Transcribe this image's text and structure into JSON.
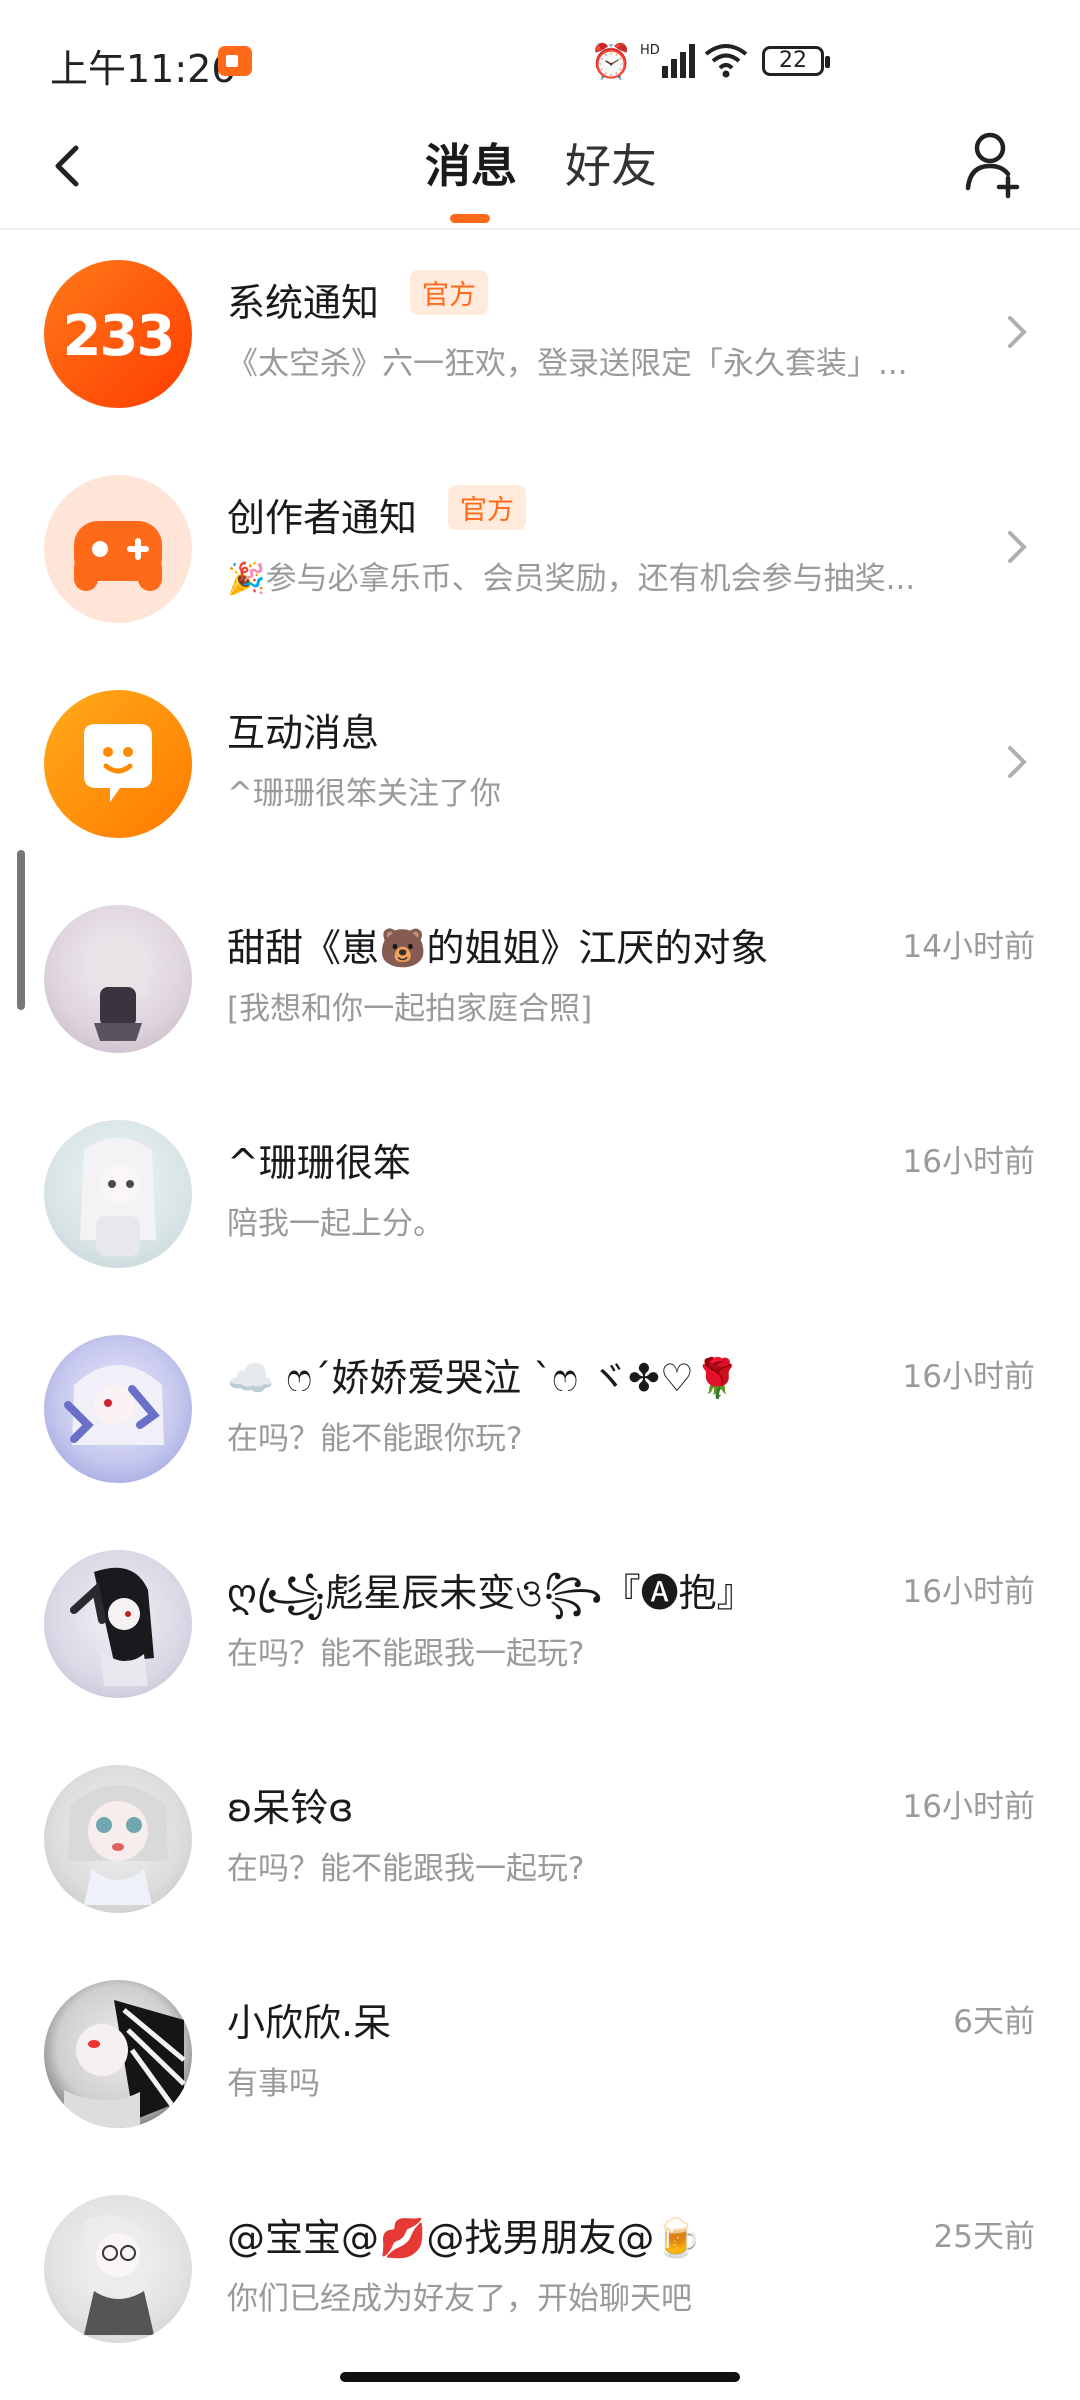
{
  "status_bar": {
    "time": "上午11:26",
    "network": "HD",
    "battery": "22"
  },
  "header": {
    "tab_active": "消息",
    "tab_other": "好友"
  },
  "notifications": [
    {
      "title": "系统通知",
      "badge": "官方",
      "subtitle": "《太空杀》六一狂欢，登录送限定「永久套装」...",
      "logo_text": "233"
    },
    {
      "title": "创作者通知",
      "badge": "官方",
      "subtitle": "🎉参与必拿乐币、会员奖励，还有机会参与抽奖..."
    },
    {
      "title": "互动消息",
      "subtitle": "^珊珊很笨关注了你"
    }
  ],
  "chats": [
    {
      "name": "甜甜《崽🐻的姐姐》江厌的对象",
      "message": "[我想和你一起拍家庭合照]",
      "time": "14小时前"
    },
    {
      "name": "^珊珊很笨",
      "message": "陪我一起上分。",
      "time": "16小时前"
    },
    {
      "name": "☁️ ෆ´娇娇爱哭泣 `ෆ ヾ✤♡🌹",
      "message": "在吗？能不能跟你玩?",
      "time": "16小时前"
    },
    {
      "name": "ღ꧁ꦿ彪星辰未变ও꧂『🅐抱』",
      "message": "在吗？能不能跟我一起玩?",
      "time": "16小时前"
    },
    {
      "name": "ʚ呆铃ɞ",
      "message": "在吗？能不能跟我一起玩?",
      "time": "16小时前"
    },
    {
      "name": "小欣欣.呆",
      "message": "有事吗",
      "time": "6天前"
    },
    {
      "name": "@宝宝@💋@找男朋友@🍺",
      "message": "你们已经成为好友了，开始聊天吧",
      "time": "25天前"
    }
  ],
  "colors": {
    "accent": "#ff6a1a",
    "badge_bg": "#ffeadb",
    "muted_text": "#9a9a9a"
  }
}
